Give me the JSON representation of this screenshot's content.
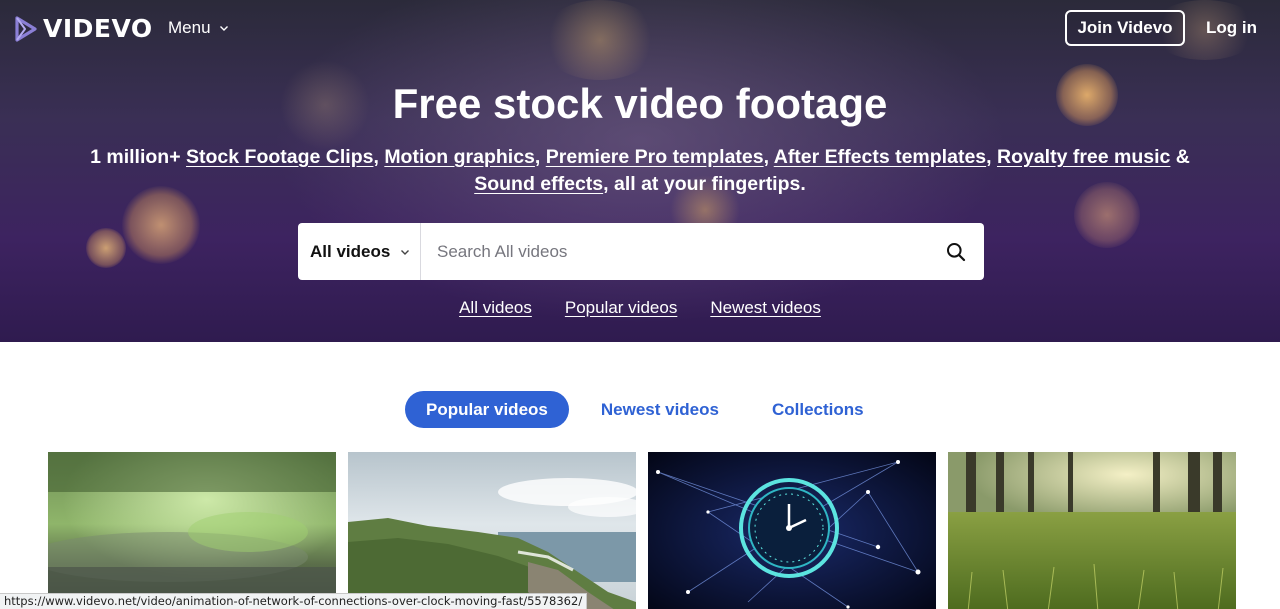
{
  "brand": {
    "name": "VIDEVO"
  },
  "nav": {
    "menu_label": "Menu",
    "join_label": "Join Videvo",
    "login_label": "Log in"
  },
  "hero": {
    "title": "Free stock video footage",
    "subtitle_prefix": "1 million+ ",
    "links": {
      "stock_footage": "Stock Footage Clips",
      "motion_graphics": "Motion graphics",
      "premiere": "Premiere Pro templates",
      "after_effects": "After Effects templates",
      "music": "Royalty free music",
      "sound_effects": "Sound effects"
    },
    "sep_comma": ", ",
    "sep_amp": " & ",
    "subtitle_suffix": ", all at your fingertips."
  },
  "search": {
    "category": "All videos",
    "placeholder": "Search All videos"
  },
  "quick_links": [
    "All videos",
    "Popular videos",
    "Newest videos"
  ],
  "tabs": [
    "Popular videos",
    "Newest videos",
    "Collections"
  ],
  "thumbnails": [
    {
      "icon": "rain-forest-thumbnail"
    },
    {
      "icon": "coastline-thumbnail"
    },
    {
      "icon": "clock-network-thumbnail"
    },
    {
      "icon": "forest-grass-thumbnail"
    }
  ],
  "status_bar": {
    "url": "https://www.videvo.net/video/animation-of-network-of-connections-over-clock-moving-fast/5578362/"
  },
  "colors": {
    "accent": "#2f62d4",
    "hero_bg": "#3d2360",
    "logo_mark": "#8b7fd6"
  }
}
